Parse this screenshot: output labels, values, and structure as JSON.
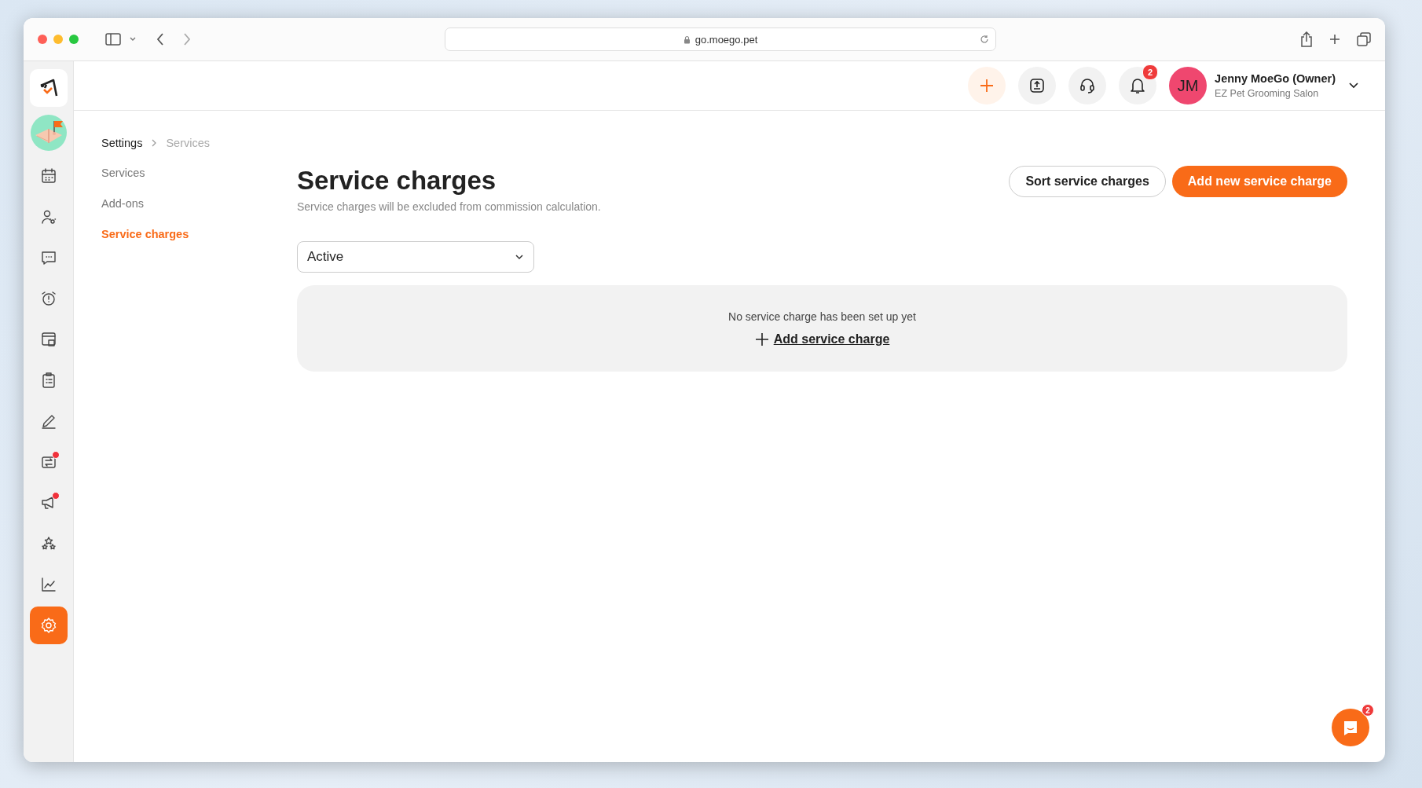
{
  "browser": {
    "address": "go.moego.pet"
  },
  "sidebar": {
    "items": [
      {
        "selected": false,
        "notification": false
      },
      {
        "selected": false,
        "notification": false
      },
      {
        "selected": false,
        "notification": false
      },
      {
        "selected": false,
        "notification": false
      },
      {
        "selected": false,
        "notification": false
      },
      {
        "selected": false,
        "notification": false
      },
      {
        "selected": false,
        "notification": false
      },
      {
        "selected": false,
        "notification": true
      },
      {
        "selected": false,
        "notification": true
      },
      {
        "selected": false,
        "notification": false
      },
      {
        "selected": false,
        "notification": false
      },
      {
        "selected": true,
        "notification": false
      }
    ]
  },
  "header": {
    "notification_count": "2",
    "avatar_initials": "JM",
    "user_name": "Jenny MoeGo (Owner)",
    "business": "EZ Pet Grooming Salon"
  },
  "breadcrumb": [
    {
      "label": "Settings",
      "current": false
    },
    {
      "label": "Services",
      "current": true
    }
  ],
  "settings_nav": [
    {
      "label": "Services",
      "selected": false
    },
    {
      "label": "Add-ons",
      "selected": false
    },
    {
      "label": "Service charges",
      "selected": true
    }
  ],
  "page": {
    "title": "Service charges",
    "subtitle": "Service charges will be excluded from commission calculation.",
    "buttons": [
      {
        "label": "Sort service charges",
        "kind": "secondary"
      },
      {
        "label": "Add new service charge",
        "kind": "primary"
      }
    ],
    "status_filter": {
      "value": "Active"
    },
    "empty_state": {
      "message": "No service charge has been set up yet",
      "link": "Add service charge"
    }
  },
  "chat": {
    "badge": "2"
  }
}
